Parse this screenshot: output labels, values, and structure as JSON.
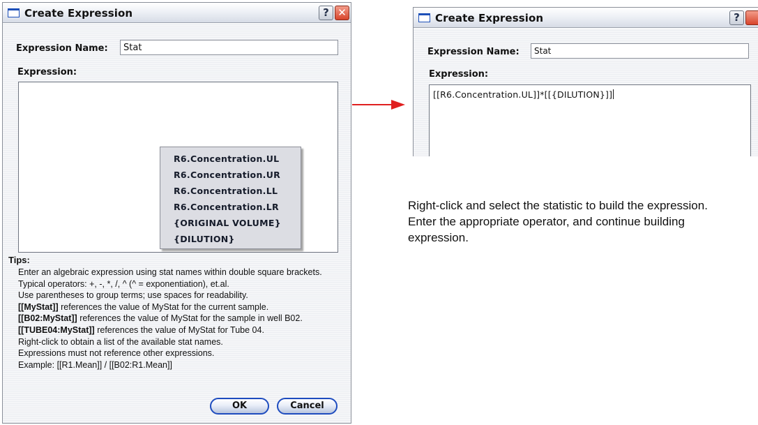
{
  "left_dialog": {
    "title": "Create Expression",
    "help_glyph": "?",
    "close_glyph": "✕",
    "name_label": "Expression Name:",
    "name_value": "Stat",
    "expression_label": "Expression:",
    "expression_value": "",
    "context_menu": {
      "items": [
        {
          "label": "R6.Concentration.UL"
        },
        {
          "label": "R6.Concentration.UR"
        },
        {
          "label": "R6.Concentration.LL"
        },
        {
          "label": "R6.Concentration.LR"
        },
        {
          "label": "{ORIGINAL VOLUME}"
        },
        {
          "label": "{DILUTION}"
        }
      ]
    },
    "tips_title": "Tips:",
    "tips": [
      {
        "bold": "",
        "text": "Enter an algebraic expression using stat names within double square brackets."
      },
      {
        "bold": "",
        "text": "Typical operators: +, -, *, /, ^ (^ = exponentiation), et.al."
      },
      {
        "bold": "",
        "text": "Use parentheses to group terms; use spaces for readability."
      },
      {
        "bold": "[[MyStat]]",
        "text": " references the value of MyStat for the current sample."
      },
      {
        "bold": "[[B02:MyStat]]",
        "text": " references the value of MyStat for the sample in well B02."
      },
      {
        "bold": "[[TUBE04:MyStat]]",
        "text": " references the value of MyStat for Tube 04."
      },
      {
        "bold": "",
        "text": "Right-click to obtain a list of the available stat names."
      },
      {
        "bold": "",
        "text": "Expressions must not reference other expressions."
      },
      {
        "bold": "",
        "text": "Example: [[R1.Mean]] / [[B02:R1.Mean]]"
      }
    ],
    "ok_label": "OK",
    "cancel_label": "Cancel"
  },
  "right_dialog": {
    "title": "Create Expression",
    "help_glyph": "?",
    "name_label": "Expression Name:",
    "name_value": "Stat",
    "expression_label": "Expression:",
    "expression_value": "[[R6.Concentration.UL]]*[[{DILUTION}]]"
  },
  "caption": {
    "lines": [
      "Right-click and select the statistic to build the expression.",
      "Enter the appropriate operator, and continue building",
      "expression."
    ]
  },
  "colors": {
    "arrow": "#e02020",
    "title_accent": "#1c4fb8",
    "button_border": "#1e4cbf",
    "close_button": "#d8452c"
  },
  "icons": {
    "window": "window-icon",
    "help": "help-icon",
    "close": "close-icon",
    "arrow": "right-arrow-icon"
  }
}
